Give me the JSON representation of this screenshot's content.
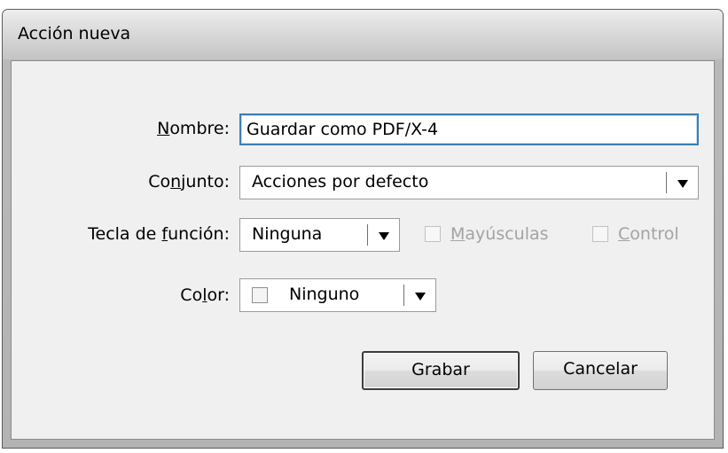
{
  "window": {
    "title": "Acción nueva"
  },
  "form": {
    "name_label_mnemonic": "N",
    "name_label_rest": "ombre:",
    "name_value": "Guardar como PDF/X-4",
    "set_label_pre": "Co",
    "set_label_mnemonic": "n",
    "set_label_post": "junto:",
    "set_value": "Acciones por defecto",
    "fkey_label_pre": "Tecla de ",
    "fkey_label_mnemonic": "f",
    "fkey_label_post": "unción:",
    "fkey_value": "Ninguna",
    "shift_mnemonic": "M",
    "shift_rest": "ayúsculas",
    "control_mnemonic": "C",
    "control_rest": "ontrol",
    "color_label_pre": "Co",
    "color_label_mnemonic": "l",
    "color_label_post": "or:",
    "color_value": "Ninguno"
  },
  "buttons": {
    "record_label": "Grabar",
    "cancel_label": "Cancelar"
  },
  "icons": {
    "dropdown": "triangle-down-icon",
    "checkbox": "checkbox-unchecked-icon",
    "swatch": "color-swatch-icon"
  }
}
